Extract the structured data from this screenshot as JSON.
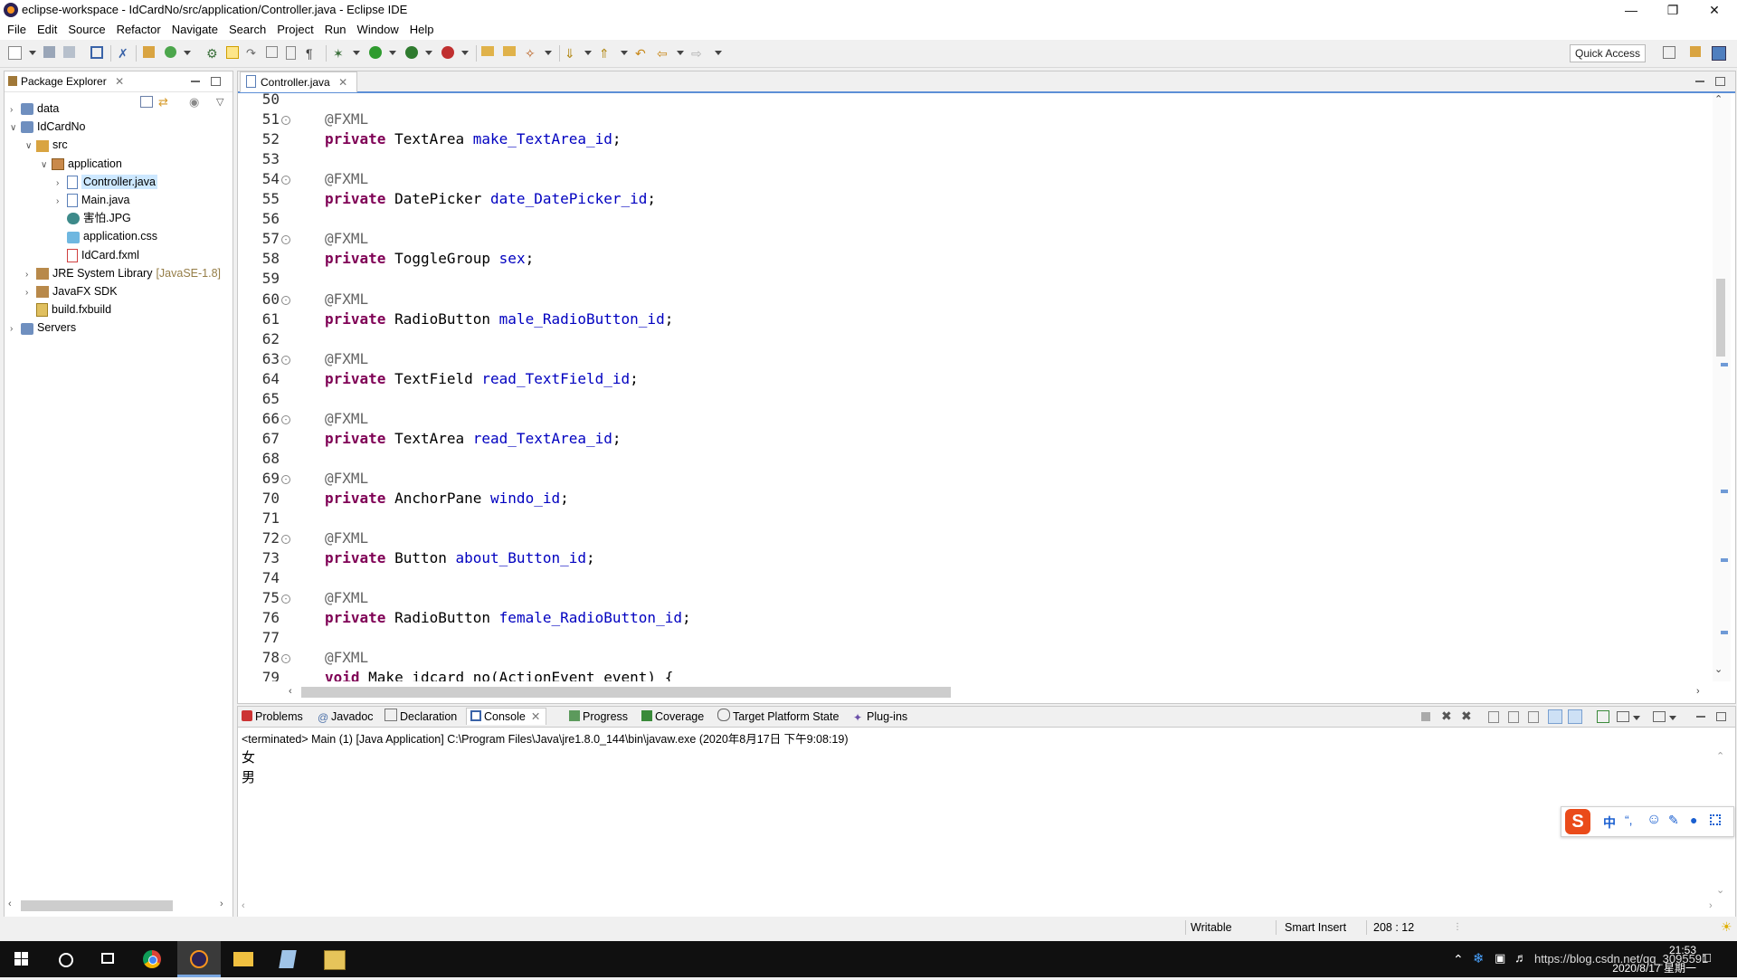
{
  "window": {
    "title": "eclipse-workspace - IdCardNo/src/application/Controller.java - Eclipse IDE"
  },
  "menu": [
    "File",
    "Edit",
    "Source",
    "Refactor",
    "Navigate",
    "Search",
    "Project",
    "Run",
    "Window",
    "Help"
  ],
  "toolbar": {
    "quick_access": "Quick Access"
  },
  "package_explorer": {
    "title": "Package Explorer",
    "tree": [
      {
        "label": "data",
        "depth": 0,
        "arrow": "›",
        "icon": "project-folder-icon"
      },
      {
        "label": "IdCardNo",
        "depth": 0,
        "arrow": "⌄",
        "icon": "project-folder-icon"
      },
      {
        "label": "src",
        "depth": 1,
        "arrow": "⌄",
        "icon": "source-folder-icon"
      },
      {
        "label": "application",
        "depth": 2,
        "arrow": "⌄",
        "icon": "package-icon"
      },
      {
        "label": "Controller.java",
        "depth": 3,
        "arrow": "›",
        "icon": "java-file-icon",
        "selected": true
      },
      {
        "label": "Main.java",
        "depth": 3,
        "arrow": "›",
        "icon": "java-file-icon"
      },
      {
        "label": "害怕.JPG",
        "depth": 3,
        "arrow": "",
        "icon": "image-file-icon"
      },
      {
        "label": "application.css",
        "depth": 3,
        "arrow": "",
        "icon": "css-file-icon"
      },
      {
        "label": "IdCard.fxml",
        "depth": 3,
        "arrow": "",
        "icon": "fxml-file-icon"
      },
      {
        "label": "JRE System Library",
        "suffix": "[JavaSE-1.8]",
        "depth": 1,
        "arrow": "›",
        "icon": "library-icon"
      },
      {
        "label": "JavaFX SDK",
        "depth": 1,
        "arrow": "›",
        "icon": "library-icon"
      },
      {
        "label": "build.fxbuild",
        "depth": 1,
        "arrow": "",
        "icon": "build-file-icon"
      },
      {
        "label": "Servers",
        "depth": 0,
        "arrow": "›",
        "icon": "project-folder-icon"
      }
    ]
  },
  "editor": {
    "tab": "Controller.java",
    "lines": [
      {
        "n": "50",
        "fold": false,
        "parts": []
      },
      {
        "n": "51",
        "fold": true,
        "parts": [
          [
            "ann",
            "@FXML"
          ]
        ]
      },
      {
        "n": "52",
        "fold": false,
        "parts": [
          [
            "kw",
            "private"
          ],
          [
            "txt",
            " TextArea "
          ],
          [
            "fld",
            "make_TextArea_id"
          ],
          [
            "txt",
            ";"
          ]
        ]
      },
      {
        "n": "53",
        "fold": false,
        "parts": []
      },
      {
        "n": "54",
        "fold": true,
        "parts": [
          [
            "ann",
            "@FXML"
          ]
        ]
      },
      {
        "n": "55",
        "fold": false,
        "parts": [
          [
            "kw",
            "private"
          ],
          [
            "txt",
            " DatePicker "
          ],
          [
            "fld",
            "date_DatePicker_id"
          ],
          [
            "txt",
            ";"
          ]
        ]
      },
      {
        "n": "56",
        "fold": false,
        "parts": []
      },
      {
        "n": "57",
        "fold": true,
        "parts": [
          [
            "ann",
            "@FXML"
          ]
        ]
      },
      {
        "n": "58",
        "fold": false,
        "parts": [
          [
            "kw",
            "private"
          ],
          [
            "txt",
            " ToggleGroup "
          ],
          [
            "fld",
            "sex"
          ],
          [
            "txt",
            ";"
          ]
        ]
      },
      {
        "n": "59",
        "fold": false,
        "parts": []
      },
      {
        "n": "60",
        "fold": true,
        "parts": [
          [
            "ann",
            "@FXML"
          ]
        ]
      },
      {
        "n": "61",
        "fold": false,
        "parts": [
          [
            "kw",
            "private"
          ],
          [
            "txt",
            " RadioButton "
          ],
          [
            "fld",
            "male_RadioButton_id"
          ],
          [
            "txt",
            ";"
          ]
        ]
      },
      {
        "n": "62",
        "fold": false,
        "parts": []
      },
      {
        "n": "63",
        "fold": true,
        "parts": [
          [
            "ann",
            "@FXML"
          ]
        ]
      },
      {
        "n": "64",
        "fold": false,
        "parts": [
          [
            "kw",
            "private"
          ],
          [
            "txt",
            " TextField "
          ],
          [
            "fld",
            "read_TextField_id"
          ],
          [
            "txt",
            ";"
          ]
        ]
      },
      {
        "n": "65",
        "fold": false,
        "parts": []
      },
      {
        "n": "66",
        "fold": true,
        "parts": [
          [
            "ann",
            "@FXML"
          ]
        ]
      },
      {
        "n": "67",
        "fold": false,
        "parts": [
          [
            "kw",
            "private"
          ],
          [
            "txt",
            " TextArea "
          ],
          [
            "fld",
            "read_TextArea_id"
          ],
          [
            "txt",
            ";"
          ]
        ]
      },
      {
        "n": "68",
        "fold": false,
        "parts": []
      },
      {
        "n": "69",
        "fold": true,
        "parts": [
          [
            "ann",
            "@FXML"
          ]
        ]
      },
      {
        "n": "70",
        "fold": false,
        "parts": [
          [
            "kw",
            "private"
          ],
          [
            "txt",
            " AnchorPane "
          ],
          [
            "fld",
            "windo_id"
          ],
          [
            "txt",
            ";"
          ]
        ]
      },
      {
        "n": "71",
        "fold": false,
        "parts": []
      },
      {
        "n": "72",
        "fold": true,
        "parts": [
          [
            "ann",
            "@FXML"
          ]
        ]
      },
      {
        "n": "73",
        "fold": false,
        "parts": [
          [
            "kw",
            "private"
          ],
          [
            "txt",
            " Button "
          ],
          [
            "fld",
            "about_Button_id"
          ],
          [
            "txt",
            ";"
          ]
        ]
      },
      {
        "n": "74",
        "fold": false,
        "parts": []
      },
      {
        "n": "75",
        "fold": true,
        "parts": [
          [
            "ann",
            "@FXML"
          ]
        ]
      },
      {
        "n": "76",
        "fold": false,
        "parts": [
          [
            "kw",
            "private"
          ],
          [
            "txt",
            " RadioButton "
          ],
          [
            "fld",
            "female_RadioButton_id"
          ],
          [
            "txt",
            ";"
          ]
        ]
      },
      {
        "n": "77",
        "fold": false,
        "parts": []
      },
      {
        "n": "78",
        "fold": true,
        "parts": [
          [
            "ann",
            "@FXML"
          ]
        ]
      },
      {
        "n": "79",
        "fold": false,
        "parts": [
          [
            "kw",
            "void"
          ],
          [
            "txt",
            " Make_idcard_no(ActionEvent "
          ],
          [
            "txt",
            "event"
          ],
          [
            "txt",
            ") {"
          ]
        ]
      }
    ]
  },
  "bottom_tabs": [
    "Problems",
    "Javadoc",
    "Declaration",
    "Console",
    "Progress",
    "Coverage",
    "Target Platform State",
    "Plug-ins"
  ],
  "console": {
    "header": "<terminated> Main (1) [Java Application] C:\\Program Files\\Java\\jre1.8.0_144\\bin\\javaw.exe (2020年8月17日 下午9:08:19)",
    "output": [
      "女",
      "男"
    ]
  },
  "status": {
    "writable": "Writable",
    "insert_mode": "Smart Insert",
    "position": "208 : 12"
  },
  "taskbar": {
    "time": "21:53",
    "date": "2020/8/17 星期一",
    "watermark": "https://blog.csdn.net/qq_3095591"
  },
  "colors": {
    "keyword": "#7f0055",
    "field": "#0000c0",
    "annotation": "#646464",
    "selection": "#cde8ff",
    "accent": "#5c8fd6"
  }
}
